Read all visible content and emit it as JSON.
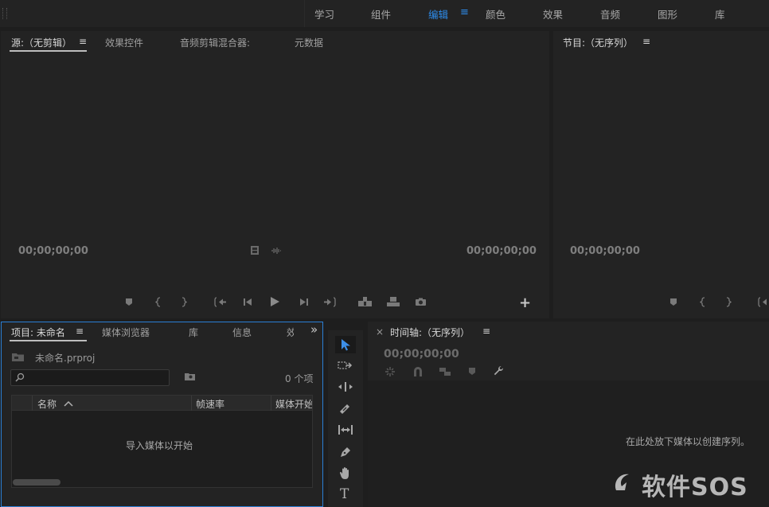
{
  "workspaces": {
    "items": [
      {
        "label": "学习",
        "active": false
      },
      {
        "label": "组件",
        "active": false
      },
      {
        "label": "编辑",
        "active": true
      },
      {
        "label": "颜色",
        "active": false
      },
      {
        "label": "效果",
        "active": false
      },
      {
        "label": "音频",
        "active": false
      },
      {
        "label": "图形",
        "active": false
      },
      {
        "label": "库",
        "active": false
      }
    ],
    "menu_glyph": "≡",
    "accent_color": "#2d8ceb"
  },
  "source_panel": {
    "tabs": [
      "源:（无剪辑）",
      "效果控件",
      "音频剪辑混合器:",
      "元数据"
    ],
    "menu_glyph": "≡",
    "timecode_left": "00;00;00;00",
    "timecode_right": "00;00;00;00",
    "add_glyph": "+"
  },
  "program_panel": {
    "title": "节目:（无序列）",
    "menu_glyph": "≡",
    "timecode": "00;00;00;00"
  },
  "project_panel": {
    "tabs": [
      "项目: 未命名",
      "媒体浏览器",
      "库",
      "信息",
      "效"
    ],
    "menu_glyph": "≡",
    "overflow_glyph": "»",
    "file_name": "未命名.prproj",
    "item_count": "0 个项",
    "columns": [
      "名称",
      "帧速率",
      "媒体开始"
    ],
    "empty_message": "导入媒体以开始",
    "border_color": "#2b7fd5"
  },
  "timeline_panel": {
    "close_glyph": "×",
    "title": "时间轴:（无序列）",
    "menu_glyph": "≡",
    "timecode": "00;00;00;00",
    "hint": "在此处放下媒体以创建序列。"
  },
  "tools": {
    "type_glyph": "T"
  },
  "watermark": "软件SOS"
}
